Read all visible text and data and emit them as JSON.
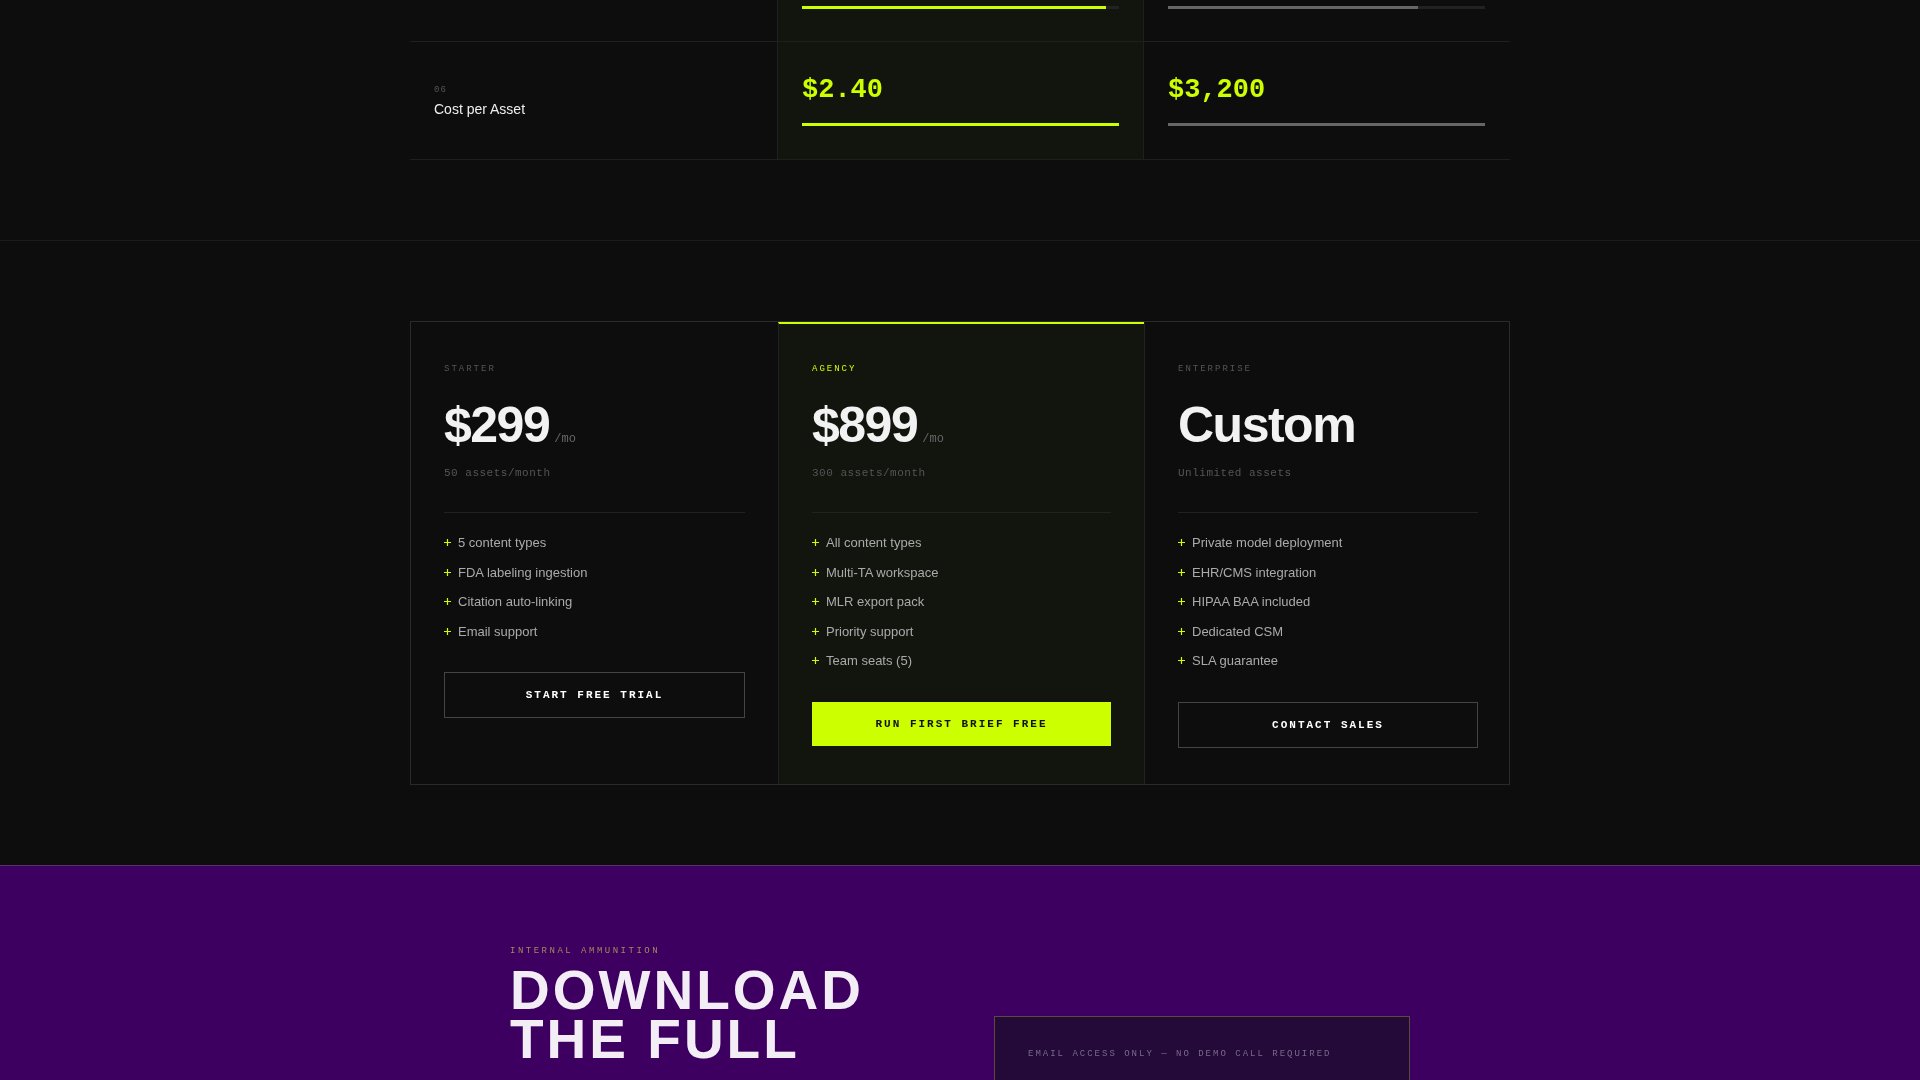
{
  "comparison": {
    "rows": [
      {
        "cells": [
          {
            "highlighted": true,
            "level": 0.96
          },
          {
            "highlighted": false,
            "level": 0.79
          }
        ]
      },
      {
        "number": "06",
        "label": "Cost per Asset",
        "cells": [
          {
            "value": "$2.40",
            "highlighted": true,
            "level": 1
          },
          {
            "value": "$3,200",
            "highlighted": false,
            "level": 1
          }
        ]
      }
    ]
  },
  "plans": [
    {
      "tier": "STARTER",
      "featured": false,
      "price": "$299",
      "period": "/mo",
      "quota": "50 assets/month",
      "features": [
        "5 content types",
        "FDA labeling ingestion",
        "Citation auto-linking",
        "Email support"
      ],
      "button": {
        "label": "START FREE TRIAL",
        "kind": "outline"
      }
    },
    {
      "tier": "AGENCY",
      "featured": true,
      "price": "$899",
      "period": "/mo",
      "quota": "300 assets/month",
      "features": [
        "All content types",
        "Multi-TA workspace",
        "MLR export pack",
        "Priority support",
        "Team seats (5)"
      ],
      "button": {
        "label": "RUN FIRST BRIEF FREE",
        "kind": "solid"
      }
    },
    {
      "tier": "ENTERPRISE",
      "featured": false,
      "price": "Custom",
      "quota": "Unlimited assets",
      "features": [
        "Private model deployment",
        "EHR/CMS integration",
        "HIPAA BAA included",
        "Dedicated CSM",
        "SLA guarantee"
      ],
      "button": {
        "label": "CONTACT SALES",
        "kind": "outline"
      }
    }
  ],
  "download": {
    "eyebrow": "INTERNAL AMMUNITION",
    "heading": "DOWNLOAD THE FULL",
    "form_note": "EMAIL ACCESS ONLY — NO DEMO CALL REQUIRED"
  }
}
